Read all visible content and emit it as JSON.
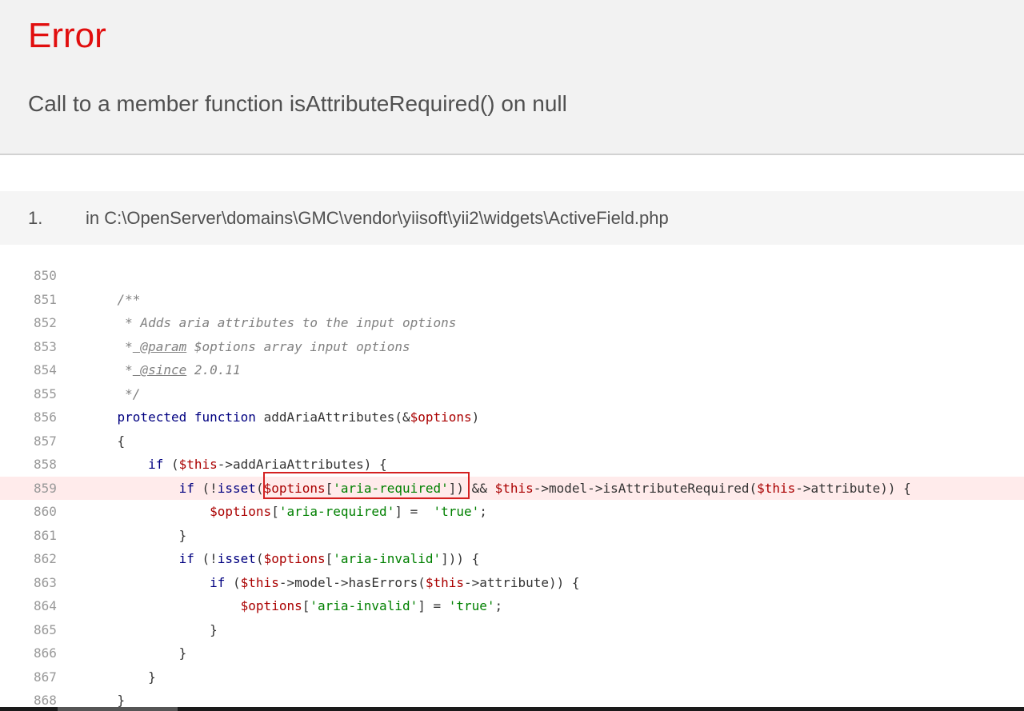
{
  "header": {
    "title": "Error",
    "message": "Call to a member function isAttributeRequired() on null"
  },
  "stack": {
    "number": "1.",
    "file": "in C:\\OpenServer\\domains\\GMC\\vendor\\yiisoft\\yii2\\widgets\\ActiveField.php",
    "error_line": "859",
    "lines": [
      {
        "num": "850",
        "tokens": []
      },
      {
        "num": "851",
        "tokens": [
          {
            "t": "    /**",
            "c": "cmt"
          }
        ]
      },
      {
        "num": "852",
        "tokens": [
          {
            "t": "     * Adds aria attributes to the input options",
            "c": "cmt"
          }
        ]
      },
      {
        "num": "853",
        "tokens": [
          {
            "t": "     *",
            "c": "cmt"
          },
          {
            "t": " @param",
            "c": "cmt tag"
          },
          {
            "t": " $options array input options",
            "c": "cmt"
          }
        ]
      },
      {
        "num": "854",
        "tokens": [
          {
            "t": "     *",
            "c": "cmt"
          },
          {
            "t": " @since",
            "c": "cmt tag"
          },
          {
            "t": " 2.0.11",
            "c": "cmt"
          }
        ]
      },
      {
        "num": "855",
        "tokens": [
          {
            "t": "     */",
            "c": "cmt"
          }
        ]
      },
      {
        "num": "856",
        "tokens": [
          {
            "t": "    ",
            "c": ""
          },
          {
            "t": "protected",
            "c": "kw"
          },
          {
            "t": " ",
            "c": ""
          },
          {
            "t": "function",
            "c": "kw"
          },
          {
            "t": " addAriaAttributes(&",
            "c": ""
          },
          {
            "t": "$options",
            "c": "var"
          },
          {
            "t": ")",
            "c": ""
          }
        ]
      },
      {
        "num": "857",
        "tokens": [
          {
            "t": "    {",
            "c": ""
          }
        ]
      },
      {
        "num": "858",
        "tokens": [
          {
            "t": "        ",
            "c": ""
          },
          {
            "t": "if",
            "c": "kw"
          },
          {
            "t": " (",
            "c": ""
          },
          {
            "t": "$this",
            "c": "var"
          },
          {
            "t": "->addAriaAttributes) {",
            "c": ""
          }
        ]
      },
      {
        "num": "859",
        "tokens": [
          {
            "t": "            ",
            "c": ""
          },
          {
            "t": "if",
            "c": "kw"
          },
          {
            "t": " (!",
            "c": ""
          },
          {
            "t": "isset",
            "c": "kw"
          },
          {
            "t": "(",
            "c": ""
          },
          {
            "t": "$options",
            "c": "var"
          },
          {
            "t": "[",
            "c": ""
          },
          {
            "t": "'aria-required'",
            "c": "str"
          },
          {
            "t": "]) && ",
            "c": ""
          },
          {
            "t": "$this",
            "c": "var"
          },
          {
            "t": "->model->isAttributeRequired(",
            "c": ""
          },
          {
            "t": "$this",
            "c": "var"
          },
          {
            "t": "->attribute)) {",
            "c": ""
          }
        ]
      },
      {
        "num": "860",
        "tokens": [
          {
            "t": "                ",
            "c": ""
          },
          {
            "t": "$options",
            "c": "var"
          },
          {
            "t": "[",
            "c": ""
          },
          {
            "t": "'aria-required'",
            "c": "str"
          },
          {
            "t": "] =  ",
            "c": ""
          },
          {
            "t": "'true'",
            "c": "str"
          },
          {
            "t": ";",
            "c": ""
          }
        ]
      },
      {
        "num": "861",
        "tokens": [
          {
            "t": "            }",
            "c": ""
          }
        ]
      },
      {
        "num": "862",
        "tokens": [
          {
            "t": "            ",
            "c": ""
          },
          {
            "t": "if",
            "c": "kw"
          },
          {
            "t": " (!",
            "c": ""
          },
          {
            "t": "isset",
            "c": "kw"
          },
          {
            "t": "(",
            "c": ""
          },
          {
            "t": "$options",
            "c": "var"
          },
          {
            "t": "[",
            "c": ""
          },
          {
            "t": "'aria-invalid'",
            "c": "str"
          },
          {
            "t": "])) {",
            "c": ""
          }
        ]
      },
      {
        "num": "863",
        "tokens": [
          {
            "t": "                ",
            "c": ""
          },
          {
            "t": "if",
            "c": "kw"
          },
          {
            "t": " (",
            "c": ""
          },
          {
            "t": "$this",
            "c": "var"
          },
          {
            "t": "->model->hasErrors(",
            "c": ""
          },
          {
            "t": "$this",
            "c": "var"
          },
          {
            "t": "->attribute)) {",
            "c": ""
          }
        ]
      },
      {
        "num": "864",
        "tokens": [
          {
            "t": "                    ",
            "c": ""
          },
          {
            "t": "$options",
            "c": "var"
          },
          {
            "t": "[",
            "c": ""
          },
          {
            "t": "'aria-invalid'",
            "c": "str"
          },
          {
            "t": "] = ",
            "c": ""
          },
          {
            "t": "'true'",
            "c": "str"
          },
          {
            "t": ";",
            "c": ""
          }
        ]
      },
      {
        "num": "865",
        "tokens": [
          {
            "t": "                }",
            "c": ""
          }
        ]
      },
      {
        "num": "866",
        "tokens": [
          {
            "t": "            }",
            "c": ""
          }
        ]
      },
      {
        "num": "867",
        "tokens": [
          {
            "t": "        }",
            "c": ""
          }
        ]
      },
      {
        "num": "868",
        "tokens": [
          {
            "t": "    }",
            "c": ""
          }
        ]
      }
    ]
  },
  "colors": {
    "title": "#e10e0e",
    "keyword": "#000080",
    "variable": "#aa0000",
    "string": "#008000",
    "comment": "#808080",
    "error_line_bg": "#ffebeb",
    "highlight_border": "#d42020"
  }
}
